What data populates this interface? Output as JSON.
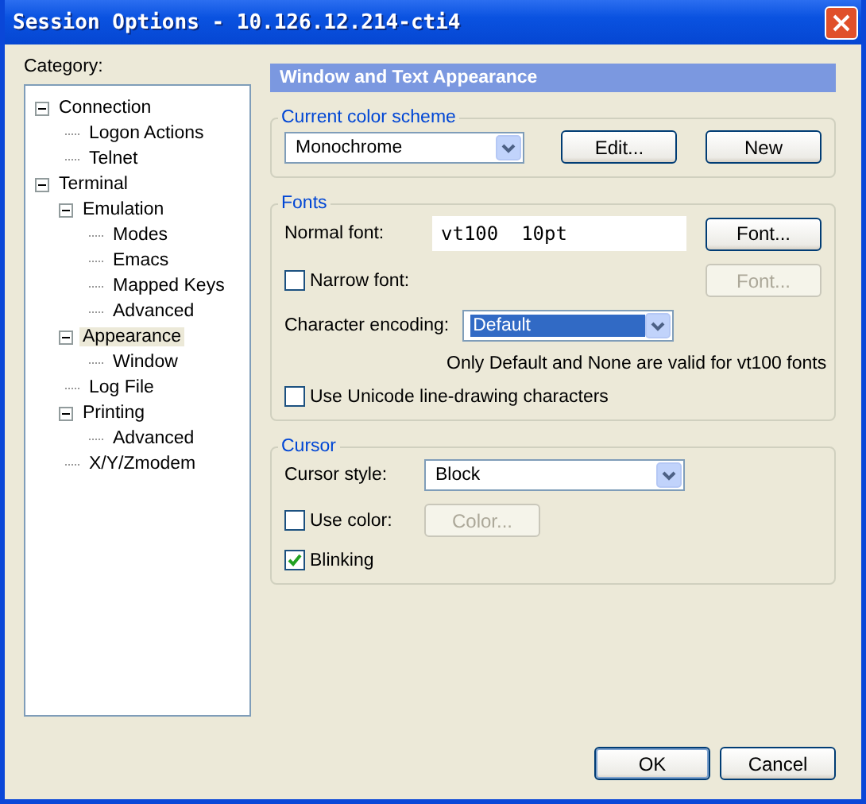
{
  "window": {
    "title": "Session Options - 10.126.12.214-cti4"
  },
  "category": {
    "label": "Category:",
    "tree": [
      {
        "label": "Connection",
        "selected": false,
        "expanded": true,
        "children": [
          {
            "label": "Logon Actions",
            "selected": false
          },
          {
            "label": "Telnet",
            "selected": false
          }
        ]
      },
      {
        "label": "Terminal",
        "selected": false,
        "expanded": true,
        "children": [
          {
            "label": "Emulation",
            "selected": false,
            "expanded": true,
            "children": [
              {
                "label": "Modes",
                "selected": false
              },
              {
                "label": "Emacs",
                "selected": false
              },
              {
                "label": "Mapped Keys",
                "selected": false
              },
              {
                "label": "Advanced",
                "selected": false
              }
            ]
          },
          {
            "label": "Appearance",
            "selected": true,
            "expanded": true,
            "children": [
              {
                "label": "Window",
                "selected": false
              }
            ]
          },
          {
            "label": "Log File",
            "selected": false
          },
          {
            "label": "Printing",
            "selected": false,
            "expanded": true,
            "children": [
              {
                "label": "Advanced",
                "selected": false
              }
            ]
          },
          {
            "label": "X/Y/Zmodem",
            "selected": false
          }
        ]
      }
    ]
  },
  "panel": {
    "header": "Window and Text Appearance",
    "color_scheme": {
      "legend": "Current color scheme",
      "value": "Monochrome",
      "edit_button": "Edit...",
      "new_button": "New"
    },
    "fonts": {
      "legend": "Fonts",
      "normal_label": "Normal font:",
      "normal_value": "vt100  10pt",
      "normal_button": "Font...",
      "narrow_label": "Narrow font:",
      "narrow_checked": false,
      "narrow_button": "Font...",
      "narrow_button_disabled": true,
      "encoding_label": "Character encoding:",
      "encoding_value": "Default",
      "encoding_note": "Only Default and None are valid for vt100 fonts",
      "unicode_label": "Use Unicode line-drawing characters",
      "unicode_checked": false
    },
    "cursor": {
      "legend": "Cursor",
      "style_label": "Cursor style:",
      "style_value": "Block",
      "color_label": "Use color:",
      "color_checked": false,
      "color_button": "Color...",
      "color_button_disabled": true,
      "blink_label": "Blinking",
      "blink_checked": true
    }
  },
  "buttons": [
    {
      "label": "OK",
      "default": true
    },
    {
      "label": "Cancel",
      "default": false
    }
  ]
}
